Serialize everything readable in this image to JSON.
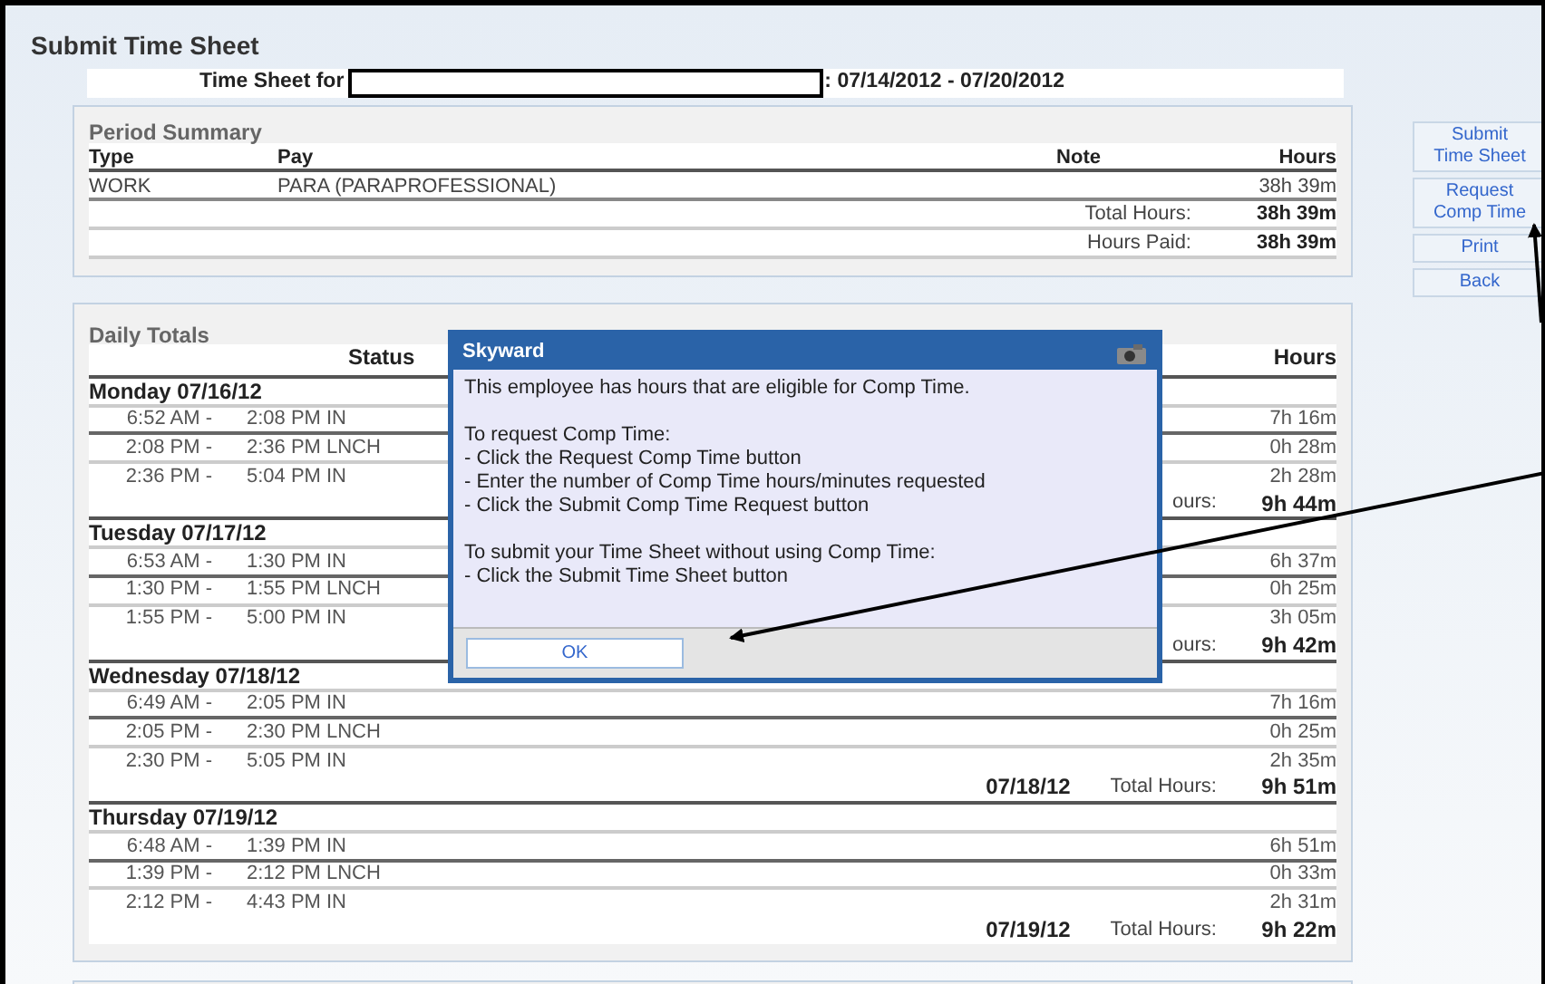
{
  "page_title": "Submit Time Sheet",
  "time_sheet_for": {
    "label": "Time Sheet for",
    "period": ": 07/14/2012 - 07/20/2012"
  },
  "period_summary": {
    "title": "Period Summary",
    "columns": [
      "Type",
      "Pay",
      "Note",
      "Hours"
    ],
    "rows": [
      {
        "type": "WORK",
        "pay": "PARA (PARAPROFESSIONAL)",
        "hours": "38h 39m"
      }
    ],
    "totals": [
      {
        "label": "Total Hours:",
        "value": "38h 39m"
      },
      {
        "label": "Hours Paid:",
        "value": "38h 39m"
      }
    ]
  },
  "actions": [
    "Submit Time Sheet",
    "Request Comp Time",
    "Print",
    "Back"
  ],
  "daily_totals": {
    "title": "Daily Totals",
    "columns": [
      "Status",
      "Hours"
    ],
    "days": [
      {
        "heading": "Monday 07/16/12",
        "entries": [
          {
            "start": "6:52 AM -",
            "end": "2:08 PM",
            "status": "IN",
            "hours": "7h 16m"
          },
          {
            "start": "2:08 PM -",
            "end": "2:36 PM",
            "status": "LNCH",
            "hours": "0h 28m"
          },
          {
            "start": "2:36 PM -",
            "end": "5:04 PM",
            "status": "IN",
            "hours": "2h 28m"
          }
        ],
        "total": {
          "label": "ours:",
          "value": "9h 44m"
        }
      },
      {
        "heading": "Tuesday 07/17/12",
        "entries": [
          {
            "start": "6:53 AM -",
            "end": "1:30 PM",
            "status": "IN",
            "hours": "6h 37m"
          },
          {
            "start": "1:30 PM -",
            "end": "1:55 PM",
            "status": "LNCH",
            "hours": "0h 25m"
          },
          {
            "start": "1:55 PM -",
            "end": "5:00 PM",
            "status": "IN",
            "hours": "3h 05m"
          }
        ],
        "total": {
          "label": "ours:",
          "value": "9h 42m"
        }
      },
      {
        "heading": "Wednesday 07/18/12",
        "entries": [
          {
            "start": "6:49 AM -",
            "end": "2:05 PM",
            "status": "IN",
            "hours": "7h 16m"
          },
          {
            "start": "2:05 PM -",
            "end": "2:30 PM",
            "status": "LNCH",
            "hours": "0h 25m"
          },
          {
            "start": "2:30 PM -",
            "end": "5:05 PM",
            "status": "IN",
            "hours": "2h 35m"
          }
        ],
        "total": {
          "date": "07/18/12",
          "label": "Total Hours:",
          "value": "9h 51m"
        }
      },
      {
        "heading": "Thursday 07/19/12",
        "entries": [
          {
            "start": "6:48 AM -",
            "end": "1:39 PM",
            "status": "IN",
            "hours": "6h 51m"
          },
          {
            "start": "1:39 PM -",
            "end": "2:12 PM",
            "status": "LNCH",
            "hours": "0h 33m"
          },
          {
            "start": "2:12 PM -",
            "end": "4:43 PM",
            "status": "IN",
            "hours": "2h 31m"
          }
        ],
        "total": {
          "date": "07/19/12",
          "label": "Total Hours:",
          "value": "9h 22m"
        }
      }
    ]
  },
  "dialog": {
    "title": "Skyward",
    "paragraphs": [
      [
        "This employee has hours that are eligible for Comp Time."
      ],
      [
        "To request Comp Time:",
        "- Click the Request Comp Time button",
        "- Enter the number of Comp Time hours/minutes requested",
        "- Click the Submit Comp Time Request button"
      ],
      [
        "To submit your Time Sheet without using Comp Time:",
        "- Click the Submit Time Sheet button"
      ]
    ],
    "button": "OK"
  }
}
